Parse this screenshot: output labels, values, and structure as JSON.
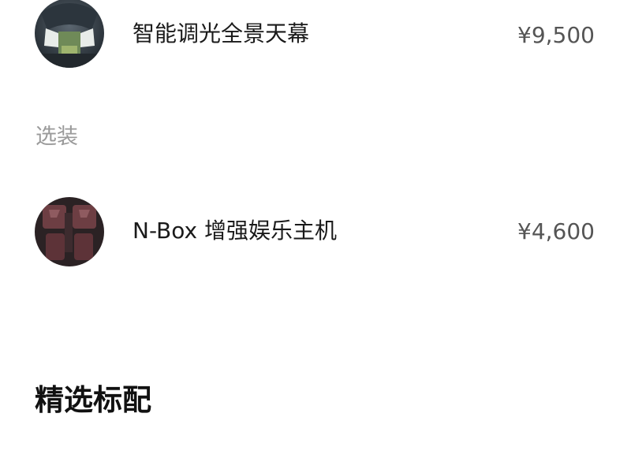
{
  "options_top": [
    {
      "name": "智能调光全景天幕",
      "price": "¥9,500",
      "thumbnail": "panoramic-roof-image"
    }
  ],
  "optional_section": {
    "label": "选装",
    "items": [
      {
        "name": "N-Box 增强娱乐主机",
        "price": "¥4,600",
        "thumbnail": "nbox-interior-image"
      }
    ]
  },
  "featured_standard": {
    "label": "精选标配"
  },
  "colors": {
    "price_gray": "#555555",
    "section_gray": "#9a9a9a",
    "text_dark": "#1a1a1a"
  }
}
